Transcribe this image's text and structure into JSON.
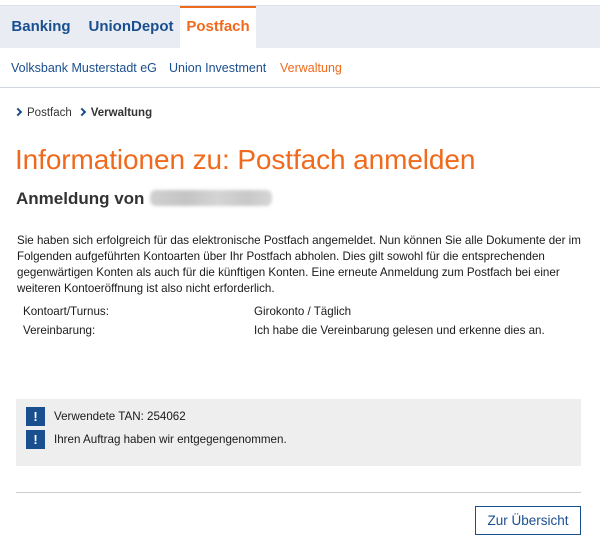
{
  "top_tabs": [
    {
      "label": "Banking"
    },
    {
      "label": "UnionDepot"
    },
    {
      "label": "Postfach",
      "active": true
    }
  ],
  "sub_nav": [
    {
      "label": "Volksbank Musterstadt eG"
    },
    {
      "label": "Union Investment"
    },
    {
      "label": "Verwaltung",
      "active": true
    }
  ],
  "breadcrumb": {
    "link": "Postfach",
    "current": "Verwaltung"
  },
  "title": "Informationen zu: Postfach anmelden",
  "subtitle": {
    "prefix": "Anmeldung von"
  },
  "intro": "Sie haben sich erfolgreich für das elektronische Postfach angemeldet. Nun können Sie alle Dokumente der im Folgenden aufgeführten Kontoarten über Ihr Postfach abholen. Dies gilt sowohl für die entsprechenden gegenwärtigen Konten als auch für die künftigen Konten. Eine erneute Anmeldung zum Postfach bei einer weiteren Kontoeröffnung ist also nicht erforderlich.",
  "details": [
    {
      "label": "Kontoart/Turnus:",
      "value": "Girokonto / Täglich"
    },
    {
      "label": "Vereinbarung:",
      "value": "Ich habe die Vereinbarung gelesen und erkenne dies an."
    }
  ],
  "messages": [
    {
      "icon": "info-icon",
      "text": "Verwendete TAN: 254062"
    },
    {
      "icon": "info-icon",
      "text": "Ihren Auftrag haben wir entgegengenommen."
    }
  ],
  "button_overview": "Zur Übersicht",
  "colors": {
    "accent_orange": "#f06a1d",
    "brand_blue": "#1a4f8f",
    "tabbar_bg": "#e9edf3",
    "message_bg": "#eeeeee"
  }
}
